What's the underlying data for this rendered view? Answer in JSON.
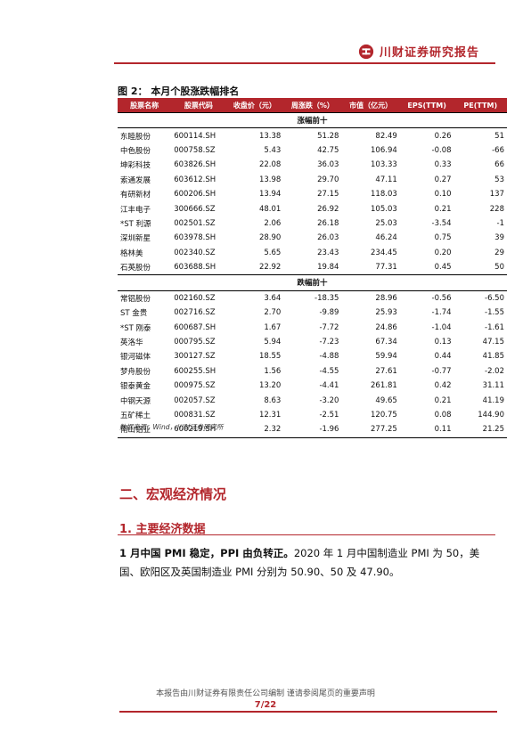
{
  "header": {
    "brand": "川财证券研究报告",
    "accent": "#b3262c"
  },
  "figure": {
    "title": "图 2：  本月个股涨跌幅排名",
    "columns": [
      "股票名称",
      "股票代码",
      "收盘价（元）",
      "周涨跌（%）",
      "市值（亿元）",
      "EPS(TTM)",
      "PE(TTM)"
    ],
    "sections": [
      {
        "label": "涨幅前十",
        "rows": [
          [
            "东睦股份",
            "600114.SH",
            "13.38",
            "51.28",
            "82.49",
            "0.26",
            "51"
          ],
          [
            "中色股份",
            "000758.SZ",
            "5.43",
            "42.75",
            "106.94",
            "-0.08",
            "-66"
          ],
          [
            "坤彩科技",
            "603826.SH",
            "22.08",
            "36.03",
            "103.33",
            "0.33",
            "66"
          ],
          [
            "索通发展",
            "603612.SH",
            "13.98",
            "29.70",
            "47.11",
            "0.27",
            "53"
          ],
          [
            "有研新材",
            "600206.SH",
            "13.94",
            "27.15",
            "118.03",
            "0.10",
            "137"
          ],
          [
            "江丰电子",
            "300666.SZ",
            "48.01",
            "26.92",
            "105.03",
            "0.21",
            "228"
          ],
          [
            "*ST 利源",
            "002501.SZ",
            "2.06",
            "26.18",
            "25.03",
            "-3.54",
            "-1"
          ],
          [
            "深圳新星",
            "603978.SH",
            "28.90",
            "26.03",
            "46.24",
            "0.75",
            "39"
          ],
          [
            "格林美",
            "002340.SZ",
            "5.65",
            "23.43",
            "234.45",
            "0.20",
            "29"
          ],
          [
            "石英股份",
            "603688.SH",
            "22.92",
            "19.84",
            "77.31",
            "0.45",
            "50"
          ]
        ]
      },
      {
        "label": "跌幅前十",
        "rows": [
          [
            "常铝股份",
            "002160.SZ",
            "3.64",
            "-18.35",
            "28.96",
            "-0.56",
            "-6.50"
          ],
          [
            "ST 金贵",
            "002716.SZ",
            "2.70",
            "-9.89",
            "25.93",
            "-1.74",
            "-1.55"
          ],
          [
            "*ST 刚泰",
            "600687.SH",
            "1.67",
            "-7.72",
            "24.86",
            "-1.04",
            "-1.61"
          ],
          [
            "英洛华",
            "000795.SZ",
            "5.94",
            "-7.23",
            "67.34",
            "0.13",
            "47.15"
          ],
          [
            "银河磁体",
            "300127.SZ",
            "18.55",
            "-4.88",
            "59.94",
            "0.44",
            "41.85"
          ],
          [
            "梦舟股份",
            "600255.SH",
            "1.56",
            "-4.55",
            "27.61",
            "-0.77",
            "-2.02"
          ],
          [
            "银泰黄金",
            "000975.SZ",
            "13.20",
            "-4.41",
            "261.81",
            "0.42",
            "31.11"
          ],
          [
            "中钢天源",
            "002057.SZ",
            "8.63",
            "-3.20",
            "49.65",
            "0.21",
            "41.19"
          ],
          [
            "五矿稀土",
            "000831.SZ",
            "12.31",
            "-2.51",
            "120.75",
            "0.08",
            "144.90"
          ],
          [
            "南山铝业",
            "600219.SH",
            "2.32",
            "-1.96",
            "277.25",
            "0.11",
            "21.25"
          ]
        ]
      }
    ],
    "source": "数据来源：Wind，川财证券研究所"
  },
  "section": {
    "title": "二、宏观经济情况"
  },
  "subsection": {
    "title": "1. 主要经济数据"
  },
  "paragraph": {
    "lead": "1 月中国 PMI 稳定，PPI 由负转正。",
    "body": "2020 年 1 月中国制造业 PMI 为 50，美国、欧阳区及英国制造业 PMI 分别为 50.90、50 及 47.90。"
  },
  "footer": {
    "disclaimer": "本报告由川财证券有限责任公司编制  谨请参阅尾页的重要声明",
    "page": "7/22"
  }
}
